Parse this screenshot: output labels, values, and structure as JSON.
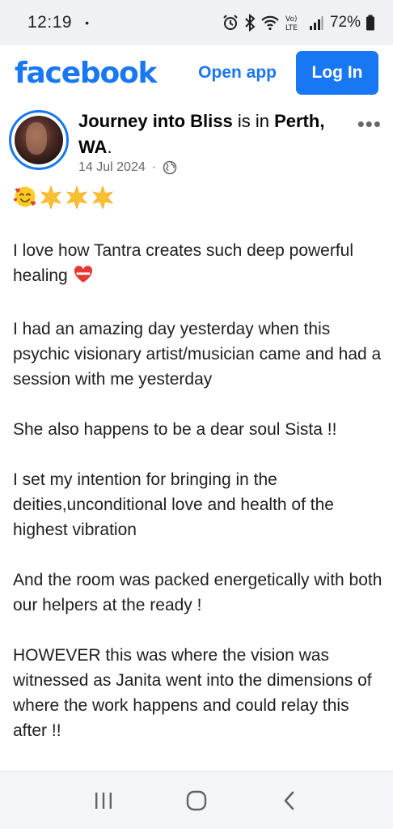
{
  "status_bar": {
    "time": "12:19",
    "dot": "•",
    "lte_label": "Vo) LTE",
    "battery": "72%",
    "icons": [
      "alarm-icon",
      "bluetooth-icon",
      "wifi-icon",
      "signal-icon",
      "battery-icon"
    ]
  },
  "header": {
    "logo": "facebook",
    "open_app": "Open app",
    "login": "Log In",
    "brand_color": "#1877f2"
  },
  "post": {
    "author": "Journey into Bliss",
    "connector": " is in ",
    "location": "Perth, WA",
    "period": ".",
    "date": "14 Jul 2024",
    "separator": "·",
    "privacy_icon": "globe-icon",
    "more": "•••",
    "emoji_line": [
      "smiling-face-with-hearts",
      "star",
      "star",
      "star"
    ],
    "paragraphs": [
      "I love how Tantra creates such deep powerful healing",
      "I had an amazing day yesterday when this psychic visionary artist/musician came and had a session with me yesterday",
      "She also happens to be a dear soul Sista !!",
      "I set my intention for bringing in the deities,unconditional love and health of the highest vibration",
      "And the room was packed energetically with both our helpers at the ready !",
      "HOWEVER this was where the vision was witnessed as Janita went into the dimensions of where the work happens and could relay this after !!"
    ],
    "heart_emoji": "mending-heart"
  },
  "nav": {
    "icons": [
      "recent-apps-icon",
      "home-icon",
      "back-icon"
    ]
  }
}
